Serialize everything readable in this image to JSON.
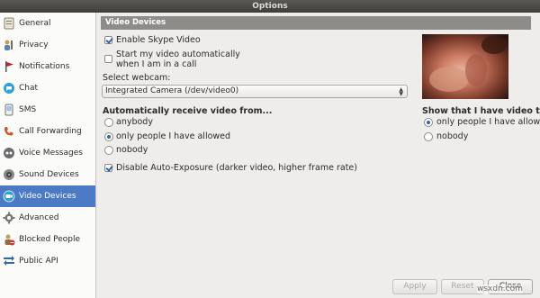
{
  "window": {
    "title": "Options"
  },
  "sidebar": {
    "items": [
      {
        "label": "General",
        "icon": "general-icon"
      },
      {
        "label": "Privacy",
        "icon": "privacy-icon"
      },
      {
        "label": "Notifications",
        "icon": "notifications-flag-icon"
      },
      {
        "label": "Chat",
        "icon": "chat-icon"
      },
      {
        "label": "SMS",
        "icon": "sms-icon"
      },
      {
        "label": "Call Forwarding",
        "icon": "call-forwarding-icon"
      },
      {
        "label": "Voice Messages",
        "icon": "voice-messages-icon"
      },
      {
        "label": "Sound Devices",
        "icon": "sound-devices-icon"
      },
      {
        "label": "Video Devices",
        "icon": "video-devices-icon",
        "selected": true
      },
      {
        "label": "Advanced",
        "icon": "gear-icon"
      },
      {
        "label": "Blocked People",
        "icon": "blocked-people-icon"
      },
      {
        "label": "Public API",
        "icon": "public-api-icon"
      }
    ]
  },
  "main": {
    "section_title": "Video Devices",
    "enable_video_label": "Enable Skype Video",
    "enable_video_checked": true,
    "auto_start_line1": "Start my video automatically",
    "auto_start_line2": "when I am in a call",
    "auto_start_checked": false,
    "select_webcam_label": "Select webcam:",
    "webcam_value": "Integrated Camera (/dev/video0)",
    "receive_title": "Automatically receive video from...",
    "receive_options": [
      "anybody",
      "only people I have allowed",
      "nobody"
    ],
    "receive_selected": "only people I have allowed",
    "show_title": "Show that I have video to...",
    "show_options": [
      "only people I have allowed",
      "nobody"
    ],
    "show_selected": "only people I have allowed",
    "auto_exposure_label": "Disable Auto-Exposure (darker video, higher frame rate)",
    "auto_exposure_checked": true
  },
  "footer": {
    "apply": "Apply",
    "reset": "Reset",
    "close": "Close"
  },
  "watermark": "wsxdn.com",
  "colors": {
    "selection": "#4a7bc4",
    "header_bar": "#8d8c89",
    "accent": "#3465a4"
  }
}
